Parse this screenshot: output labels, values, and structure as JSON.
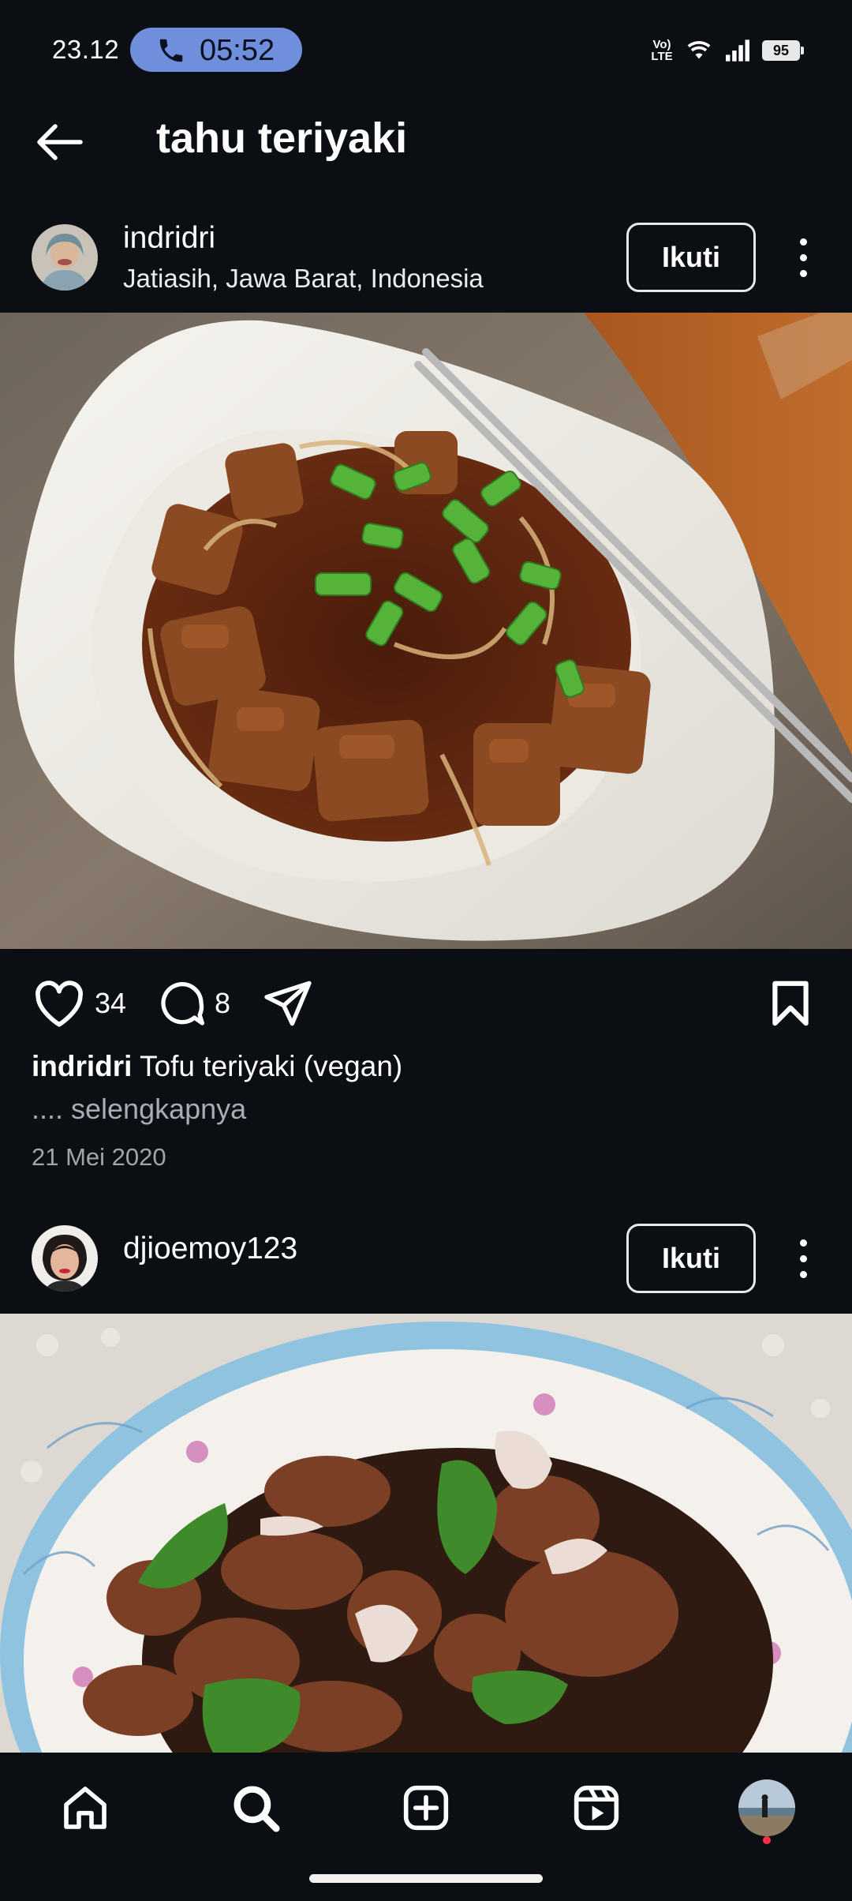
{
  "status_bar": {
    "time": "23.12",
    "call_timer": "05:52",
    "network_label": "Vo) LTE",
    "battery": "95"
  },
  "header": {
    "title": "tahu teriyaki"
  },
  "posts": [
    {
      "username": "indridri",
      "location": "Jatiasih, Jawa Barat, Indonesia",
      "follow_label": "Ikuti",
      "likes": "34",
      "comments": "8",
      "caption_user": "indridri",
      "caption_text": "Tofu teriyaki (vegan)",
      "more_label": ".... selengkapnya",
      "date": "21 Mei 2020"
    },
    {
      "username": "djioemoy123",
      "follow_label": "Ikuti"
    }
  ],
  "icons": {
    "back": "arrow-left-icon",
    "like": "heart-icon",
    "comment": "comment-icon",
    "share": "send-icon",
    "save": "bookmark-icon",
    "more": "more-vertical-icon",
    "nav": [
      "home-icon",
      "search-icon",
      "create-icon",
      "reels-icon",
      "profile-avatar"
    ]
  },
  "colors": {
    "background": "#0b0f14",
    "call_pill": "#6f8fdd",
    "notification_dot": "#ff3040"
  }
}
